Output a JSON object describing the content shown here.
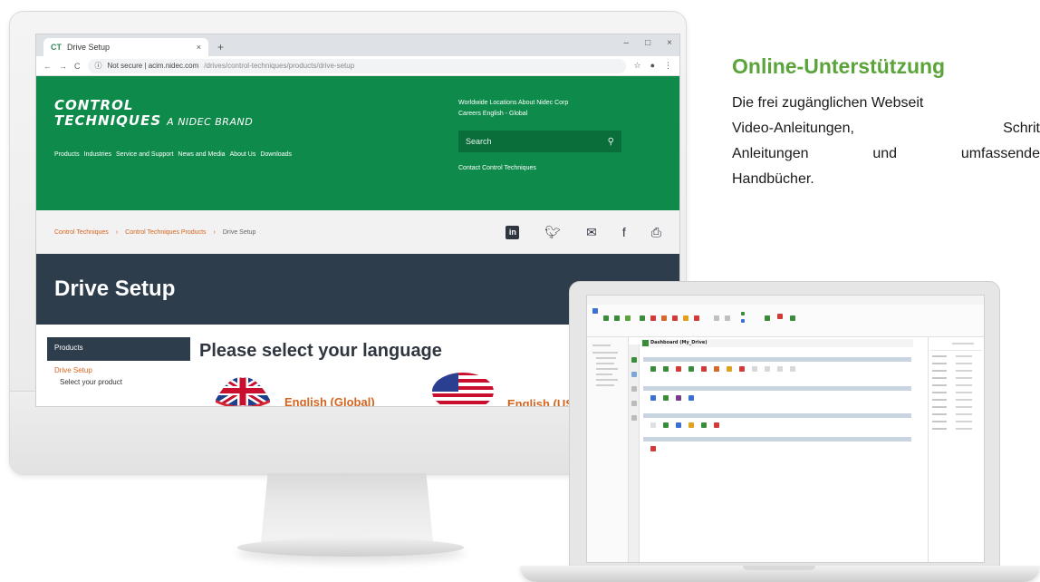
{
  "browser": {
    "tab_title": "Drive Setup",
    "tab_favicon": "CT",
    "url_host": "Not secure  |  acim.nidec.com",
    "url_path": "/drives/control-techniques/products/drive-setup",
    "window_controls": [
      "–",
      "□",
      "×"
    ]
  },
  "site": {
    "brand_line1": "CONTROL",
    "brand_line2": "TECHNIQUES",
    "brand_tag": "A NIDEC BRAND",
    "nav": [
      "Products",
      "Industries",
      "Service and Support",
      "News and Media",
      "About Us",
      "Downloads"
    ],
    "top_links_1": "Worldwide Locations   About Nidec Corp",
    "top_links_2": "Careers   English - Global",
    "search_placeholder": "Search",
    "contact": "Contact Control Techniques",
    "breadcrumb": [
      "Control Techniques",
      "Control Techniques Products",
      "Drive Setup"
    ],
    "page_title": "Drive Setup",
    "sidebar_heading": "Products",
    "sidebar_item": "Drive Setup",
    "sidebar_subitem": "Select your product",
    "language_prompt": "Please select your language",
    "languages": [
      "English (Global)",
      "English (US)"
    ],
    "colors": {
      "green": "#0e8a4a",
      "dark": "#2e3d4b",
      "orange": "#d6641f"
    }
  },
  "software": {
    "dashboard_title": "Dashboard (My_Drive)"
  },
  "text": {
    "heading": "Online-Unterstützung",
    "line1": "Die frei zugänglichen Webseit",
    "line2a": "Video-Anleitungen,",
    "line2b": "Schrit",
    "line3a": "Anleitungen",
    "line3b": "und",
    "line3c": "umfassende",
    "line4": "Handbücher.",
    "accent_color": "#5aa43a"
  }
}
